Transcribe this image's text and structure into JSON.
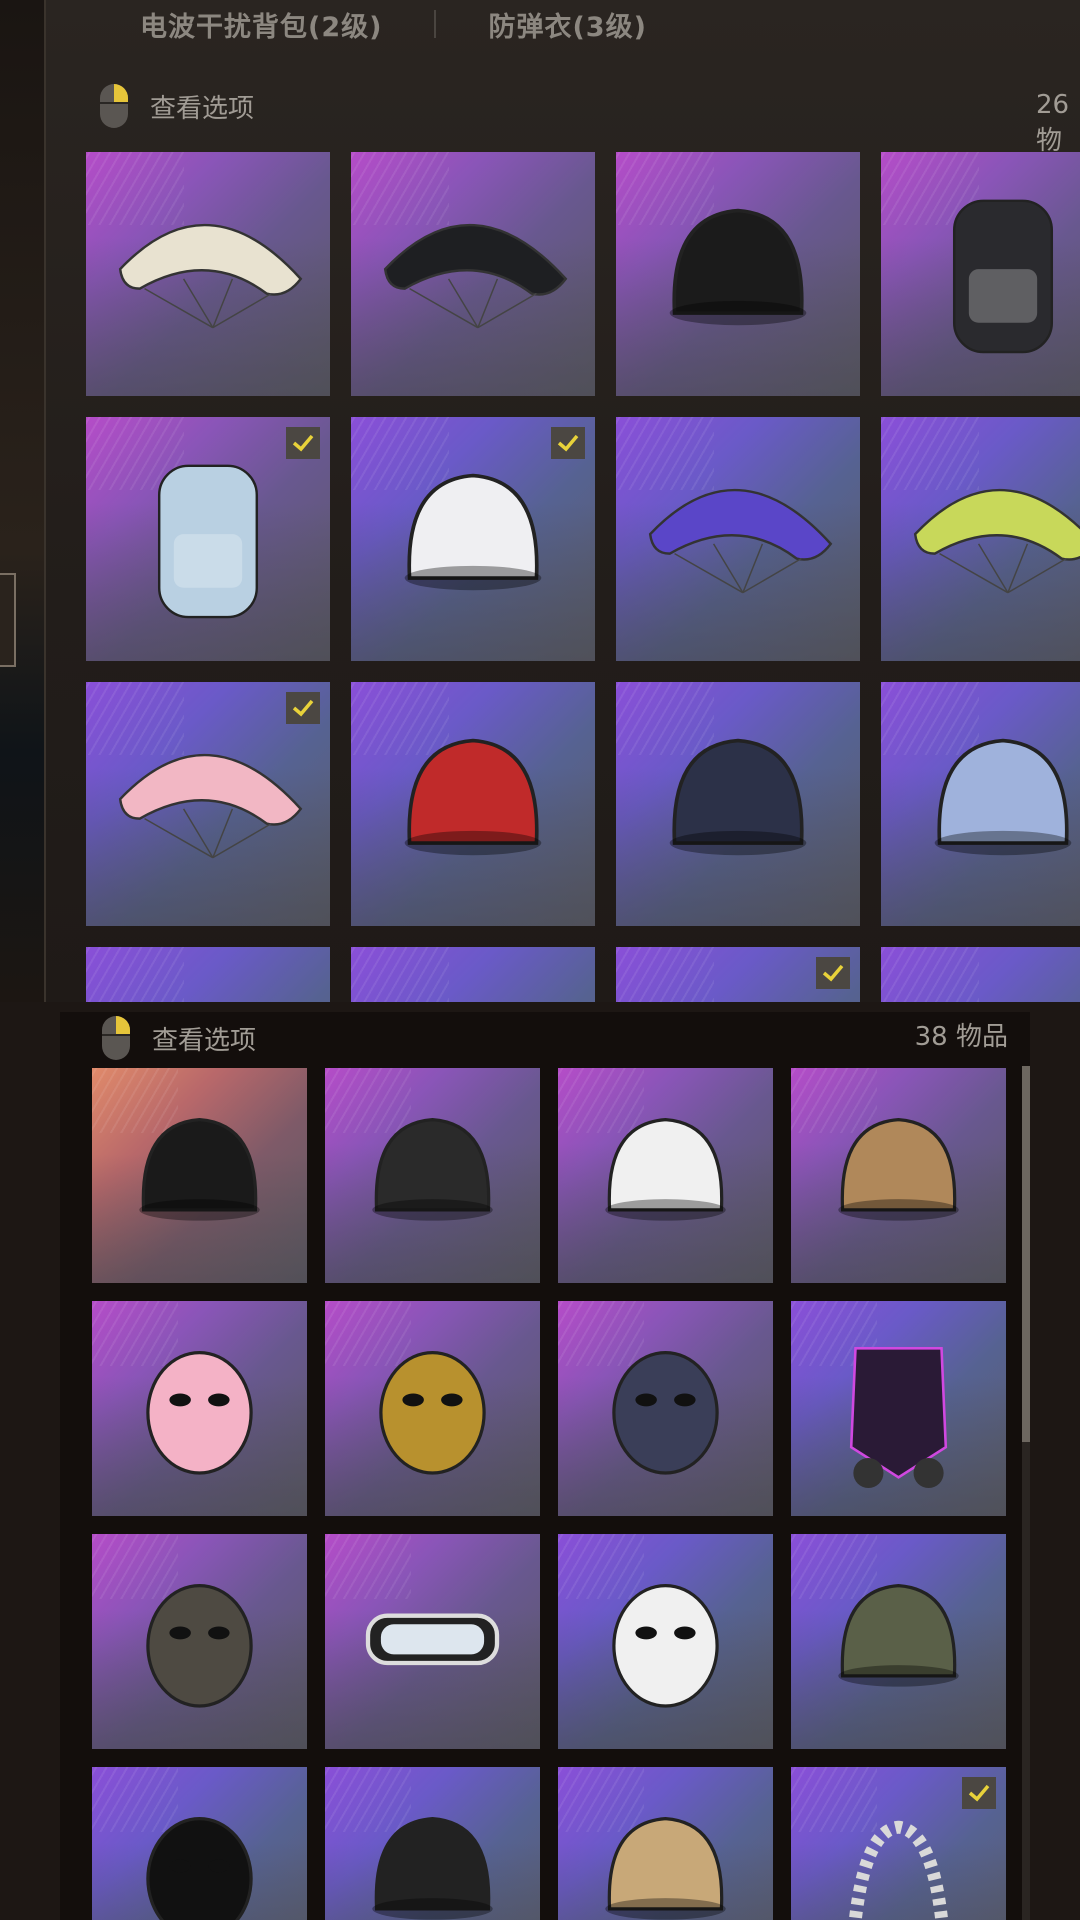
{
  "top_panel": {
    "tabs": [
      "电波干扰背包(2级)",
      "防弹衣(3级)"
    ],
    "view_options_label": "查看选项",
    "item_count_partial": "26 物"
  },
  "bottom_panel": {
    "view_options_label": "查看选项",
    "item_count": "38 物品"
  },
  "colors": {
    "checkmark": "#e8d23a",
    "tile_pink": "#b54cc8",
    "tile_blue": "#8a4fd8"
  },
  "top_items": [
    {
      "icon": "white-parachute-icon",
      "checked": false
    },
    {
      "icon": "black-parachute-icon",
      "checked": false
    },
    {
      "icon": "black-white-helmet-icon",
      "checked": false
    },
    {
      "icon": "black-backpack-icon",
      "checked": false
    },
    {
      "icon": "denim-chain-backpack-icon",
      "checked": true
    },
    {
      "icon": "white-helmet-veil-icon",
      "checked": true
    },
    {
      "icon": "purple-heart-parachute-icon",
      "checked": false
    },
    {
      "icon": "green-yellow-parachute-icon",
      "checked": false
    },
    {
      "icon": "pink-parachute-icon",
      "checked": true
    },
    {
      "icon": "red-plaid-helmet-icon",
      "checked": false
    },
    {
      "icon": "golden-knight-helmet-icon",
      "checked": false
    },
    {
      "icon": "reindeer-helmet-icon",
      "checked": false
    },
    {
      "icon": "red-item-icon",
      "checked": false
    },
    {
      "icon": "green-item-icon",
      "checked": false
    },
    {
      "icon": "dark-item-icon",
      "checked": true
    },
    {
      "icon": "pink-item-icon",
      "checked": false
    }
  ],
  "bottom_items": [
    {
      "icon": "black-bandana-icon",
      "checked": false
    },
    {
      "icon": "black-cap-icon",
      "checked": false
    },
    {
      "icon": "white-bear-beanie-icon",
      "checked": false
    },
    {
      "icon": "leopard-bucket-hat-icon",
      "checked": false
    },
    {
      "icon": "pink-poodle-mask-icon",
      "checked": false
    },
    {
      "icon": "gold-skull-mask-icon",
      "checked": false
    },
    {
      "icon": "gold-spiked-mask-icon",
      "checked": false
    },
    {
      "icon": "neon-gas-mask-icon",
      "checked": false
    },
    {
      "icon": "black-fox-mask-icon",
      "checked": false
    },
    {
      "icon": "goggles-icon",
      "checked": false
    },
    {
      "icon": "snowman-mask-icon",
      "checked": false
    },
    {
      "icon": "headset-cap-icon",
      "checked": false
    },
    {
      "icon": "black-bunny-mask-icon",
      "checked": false
    },
    {
      "icon": "devil-cap-icon",
      "checked": false
    },
    {
      "icon": "bear-hat-icon",
      "checked": false
    },
    {
      "icon": "pearl-necklace-icon",
      "checked": true
    }
  ]
}
